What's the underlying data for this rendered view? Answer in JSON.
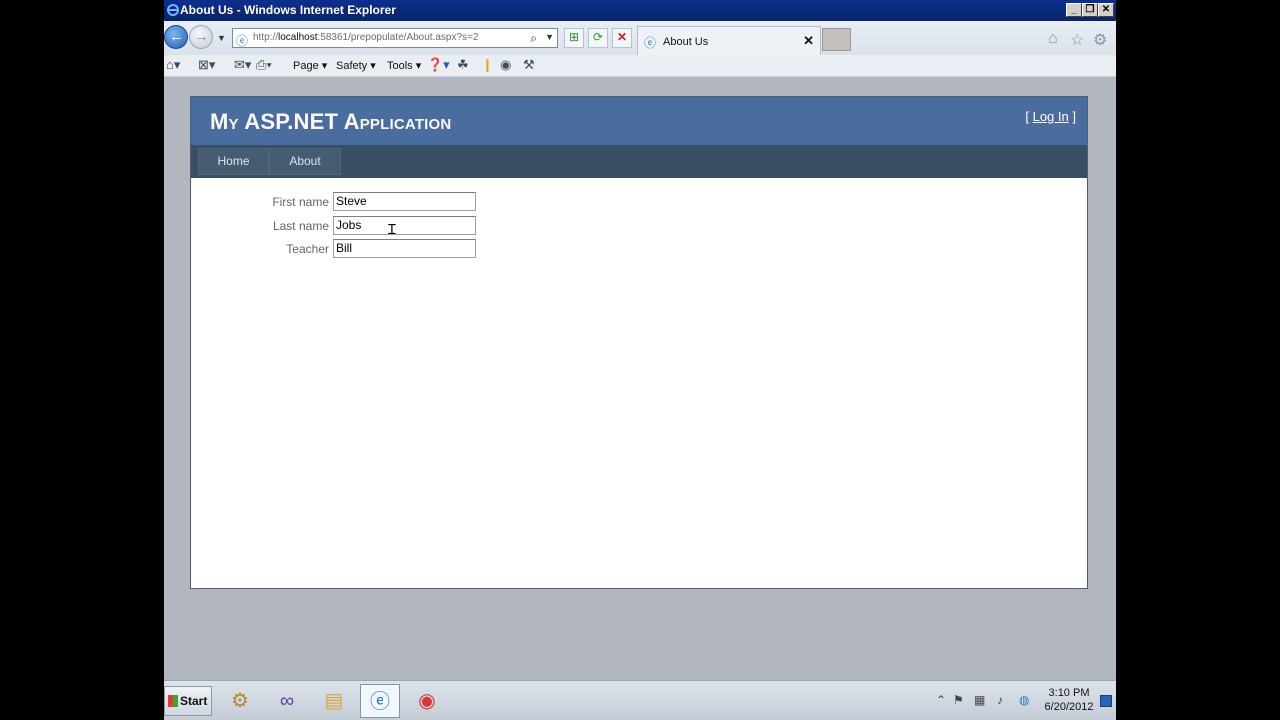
{
  "window": {
    "title": "About Us - Windows Internet Explorer"
  },
  "address_bar": {
    "url_prefix": "http://",
    "url_host": "localhost",
    "url_rest": ":58361/prepopulate/About.aspx?s=2"
  },
  "tab": {
    "label": "About Us"
  },
  "command_bar": {
    "page": "Page",
    "safety": "Safety",
    "tools": "Tools"
  },
  "site": {
    "title": "My ASP.NET Application",
    "login_open": "[",
    "login_link": "Log In",
    "login_close": "]",
    "menu": [
      {
        "label": "Home"
      },
      {
        "label": "About"
      }
    ]
  },
  "form": {
    "fields": [
      {
        "label": "First name",
        "value": "Steve"
      },
      {
        "label": "Last name",
        "value": "Jobs"
      },
      {
        "label": "Teacher",
        "value": "Bill"
      }
    ]
  },
  "taskbar": {
    "start_label": "Start",
    "time": "3:10 PM",
    "date": "6/20/2012"
  },
  "colors": {
    "header": "#4b6c9e",
    "menu": "#3a4f63",
    "titlebar": "#0a246a"
  }
}
